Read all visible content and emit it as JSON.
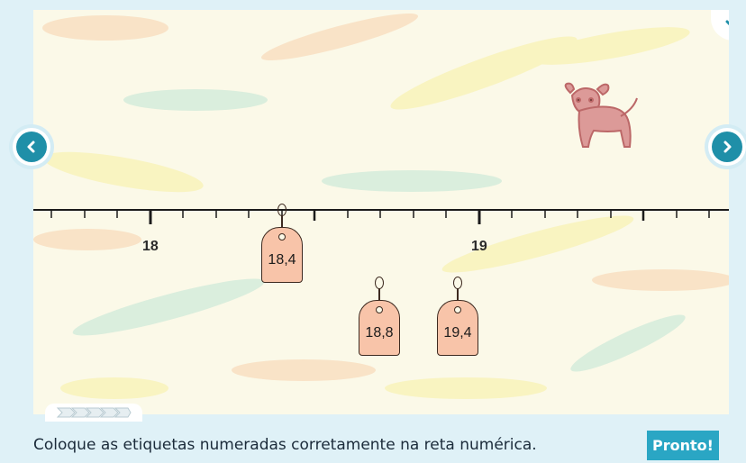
{
  "activity": {
    "instruction": "Coloque as etiquetas numeradas corretamente na reta numérica.",
    "done_label": "Pronto!"
  },
  "number_line": {
    "labels": [
      "18",
      "19"
    ]
  },
  "tags": [
    {
      "label": "18,4"
    },
    {
      "label": "18,8"
    },
    {
      "label": "19,4"
    }
  ],
  "icons": {
    "prev": "chevron-left-icon",
    "next": "chevron-right-icon",
    "collapse": "chevron-down-icon",
    "progress": "progress-chevrons-icon",
    "dog": "dog-drawing-icon"
  },
  "colors": {
    "accent": "#1f8fa8",
    "button": "#2aa6c4",
    "tag_fill": "#f8c4a9"
  }
}
